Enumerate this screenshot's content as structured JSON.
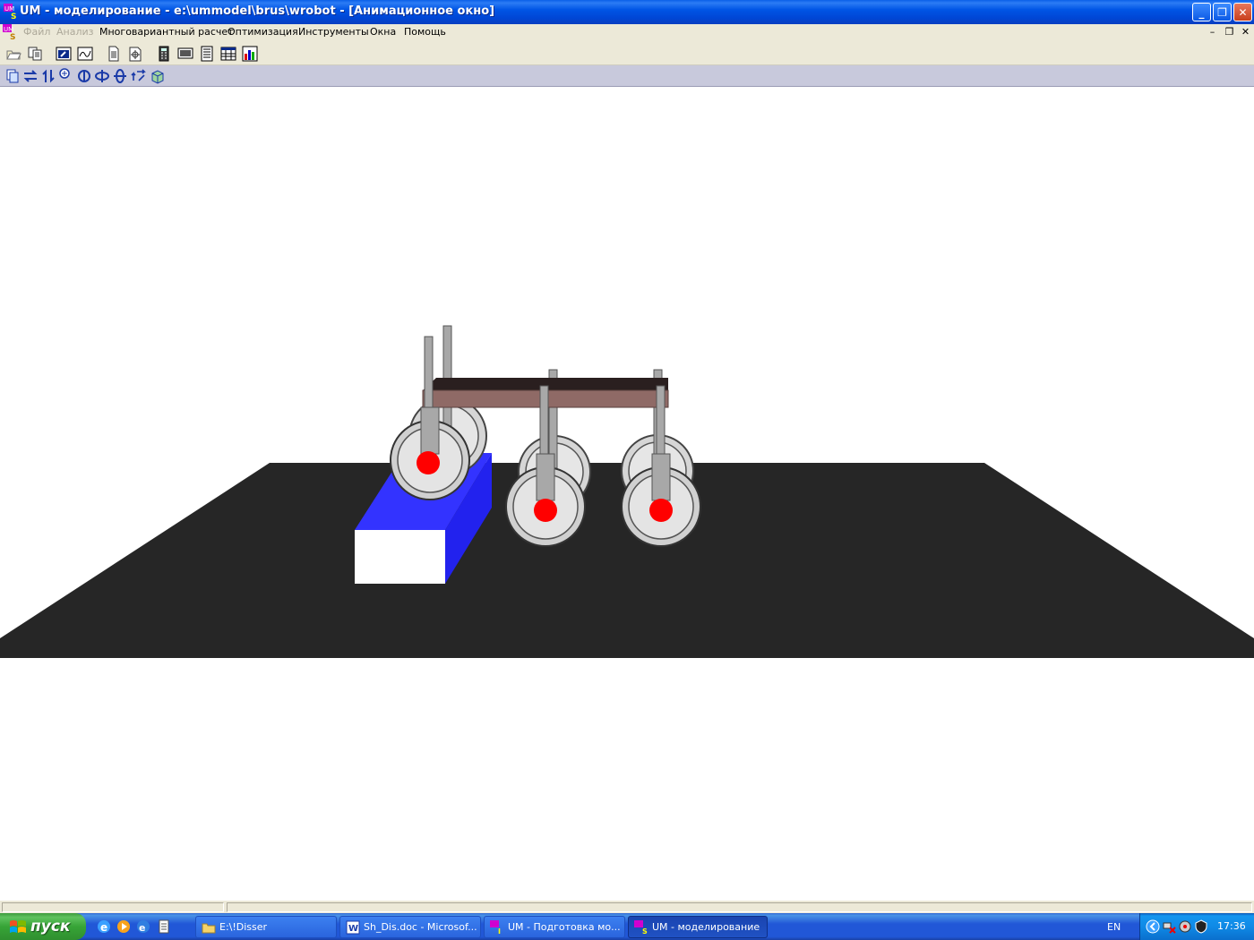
{
  "window": {
    "title": "UM - моделирование - e:\\ummodel\\brus\\wrobot - [Анимационное окно]",
    "controls": {
      "minimize": "_",
      "maximize": "❐",
      "close": "✕"
    }
  },
  "menu": {
    "items": [
      {
        "label": "Файл",
        "enabled": false
      },
      {
        "label": "Анализ",
        "enabled": false
      },
      {
        "label": "Многовариантный расчет",
        "enabled": true
      },
      {
        "label": "Оптимизация",
        "enabled": true
      },
      {
        "label": "Инструменты",
        "enabled": true
      },
      {
        "label": "Окна",
        "enabled": true
      },
      {
        "label": "Помощь",
        "enabled": true
      }
    ],
    "mdi_controls": {
      "minimize": "–",
      "restore": "❐",
      "close": "✕"
    }
  },
  "toolbar1": [
    "open-icon",
    "copy-pages-icon",
    "animation-window-icon",
    "graph-window-icon",
    "document-icon",
    "report-icon",
    "calculator-icon",
    "monitor-icon",
    "table-icon",
    "grid-icon",
    "histogram-icon"
  ],
  "toolbar2": [
    "copy-image-icon",
    "pan-horizontal-icon",
    "pan-vertical-icon",
    "zoom-icon",
    "rotate-x-icon",
    "rotate-y-icon",
    "rotate-z-icon",
    "rotate-free-icon",
    "box-view-icon"
  ],
  "scene": {
    "colors": {
      "background": "#ffffff",
      "ground": "#262626",
      "block_top": "#3333ff",
      "block_front": "#ffffff",
      "platform_top": "#2a1f1f",
      "platform_side": "#8f6a66",
      "wheel_rim": "#e0e0e0",
      "wheel_hub": "#ff0000",
      "leg": "#a0a0a0"
    }
  },
  "taskbar": {
    "start_label": "пуск",
    "quick_launch": [
      "ie-icon",
      "media-player-icon",
      "outlook-icon",
      "notepad-icon"
    ],
    "tasks": [
      {
        "label": "E:\\!Disser",
        "icon": "folder-icon",
        "active": false
      },
      {
        "label": "Sh_Dis.doc - Microsof...",
        "icon": "word-icon",
        "active": false
      },
      {
        "label": "UM - Подготовка мо...",
        "icon": "um-icon",
        "active": false
      },
      {
        "label": "UM - моделирование",
        "icon": "um-icon",
        "active": true
      }
    ],
    "language": "EN",
    "clock": "17:36"
  }
}
